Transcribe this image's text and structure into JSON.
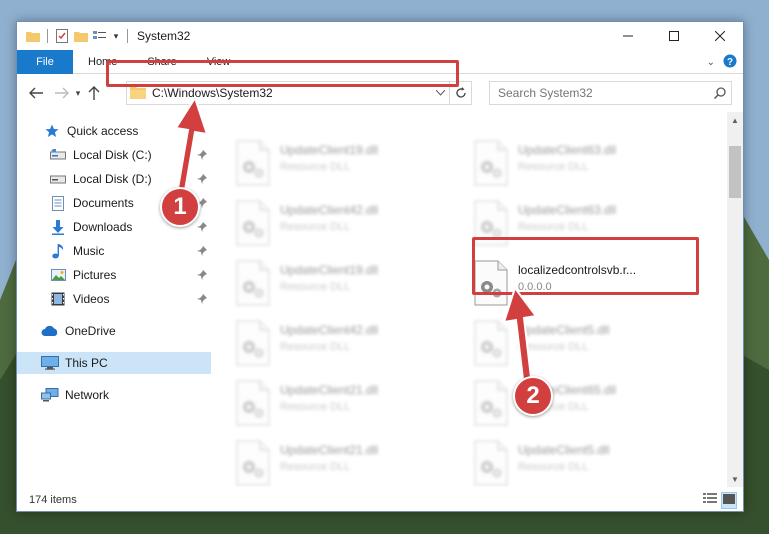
{
  "window": {
    "title": "System32"
  },
  "ribbon": {
    "tabs": [
      "File",
      "Home",
      "Share",
      "View"
    ]
  },
  "address": {
    "path": "C:\\Windows\\System32"
  },
  "search": {
    "placeholder": "Search System32"
  },
  "sidebar": {
    "items": [
      {
        "label": "Quick access",
        "icon": "star-icon"
      },
      {
        "label": "Local Disk (C:)",
        "icon": "drive-icon",
        "pinned": true
      },
      {
        "label": "Local Disk (D:)",
        "icon": "drive-icon",
        "pinned": true
      },
      {
        "label": "Documents",
        "icon": "documents-icon",
        "pinned": true
      },
      {
        "label": "Downloads",
        "icon": "download-icon",
        "pinned": true
      },
      {
        "label": "Music",
        "icon": "music-icon",
        "pinned": true
      },
      {
        "label": "Pictures",
        "icon": "pictures-icon",
        "pinned": true
      },
      {
        "label": "Videos",
        "icon": "videos-icon",
        "pinned": true
      },
      {
        "label": "OneDrive",
        "icon": "cloud-icon"
      },
      {
        "label": "This PC",
        "icon": "computer-icon",
        "selected": true
      },
      {
        "label": "Network",
        "icon": "network-icon"
      }
    ]
  },
  "files": [
    {
      "name": "UpdateClient19.dll",
      "desc": "Resource DLL"
    },
    {
      "name": "UpdateClient63.dll",
      "desc": "Resource DLL"
    },
    {
      "name": "UpdateClient42.dll",
      "desc": "Resource DLL"
    },
    {
      "name": "UpdateClient63.dll",
      "desc": "Resource DLL"
    },
    {
      "name": "UpdateClient19.dll",
      "desc": "Resource DLL"
    },
    {
      "name": "localizedcontrolsvb.r...",
      "desc": "0.0.0.0"
    },
    {
      "name": "UpdateClient42.dll",
      "desc": "Resource DLL"
    },
    {
      "name": "UpdateClient5.dll",
      "desc": "Resource DLL"
    },
    {
      "name": "UpdateClient21.dll",
      "desc": "Resource DLL"
    },
    {
      "name": "UpdateClient65.dll",
      "desc": "Resource DLL"
    },
    {
      "name": "UpdateClient21.dll",
      "desc": "Resource DLL"
    },
    {
      "name": "UpdateClient5.dll",
      "desc": "Resource DLL"
    }
  ],
  "status": {
    "count": "174 items"
  },
  "annotations": {
    "step1": "1",
    "step2": "2",
    "color": "#d23f3f"
  },
  "colors": {
    "accent": "#1979ca",
    "selected": "#cce4f7"
  }
}
